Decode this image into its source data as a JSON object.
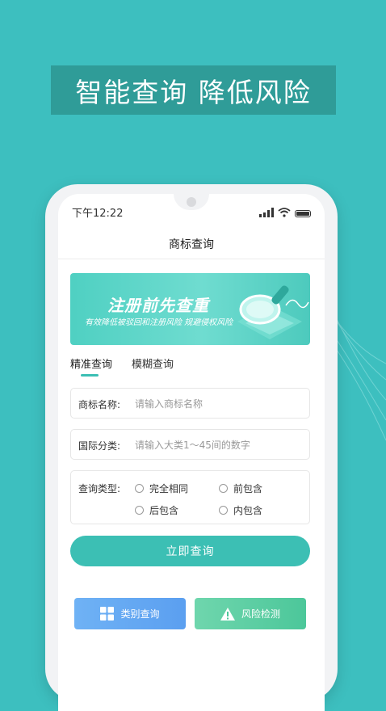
{
  "banner": {
    "text": "智能查询 降低风险"
  },
  "status_bar": {
    "time": "下午12:22"
  },
  "page": {
    "title": "商标查询"
  },
  "promo": {
    "headline": "注册前先查重",
    "subline": "有效降低被驳回和注册风险  规避侵权风险"
  },
  "tabs": [
    {
      "label": "精准查询",
      "active": true
    },
    {
      "label": "模糊查询",
      "active": false
    }
  ],
  "form": {
    "trademark_name": {
      "label": "商标名称:",
      "placeholder": "请输入商标名称",
      "value": ""
    },
    "international_class": {
      "label": "国际分类:",
      "placeholder": "请输入大类1～45间的数字",
      "value": ""
    },
    "query_type": {
      "label": "查询类型:",
      "options": [
        "完全相同",
        "前包含",
        "后包含",
        "内包含"
      ]
    },
    "submit_label": "立即查询"
  },
  "quick_actions": {
    "category_query": {
      "label": "类别查询",
      "icon": "grid-icon"
    },
    "risk_detection": {
      "label": "风险检测",
      "icon": "warning-icon"
    }
  },
  "colors": {
    "background": "#3dbfbf",
    "banner": "#2f9c98",
    "accent": "#3cbfb4",
    "category_button": "#5b9ff0",
    "risk_button": "#4cc79a"
  }
}
